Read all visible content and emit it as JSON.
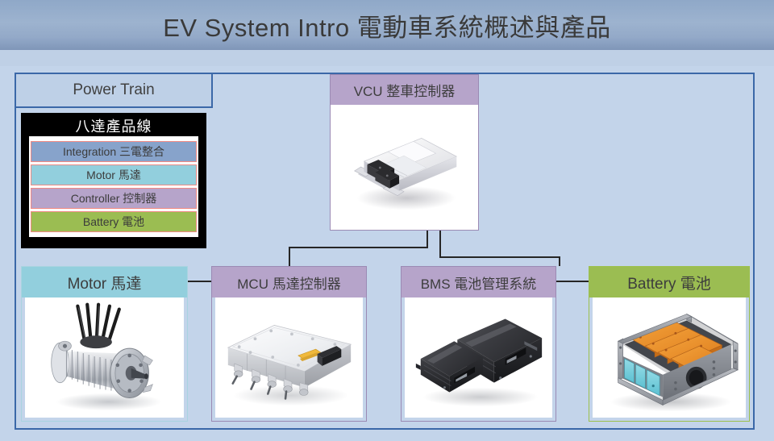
{
  "header": {
    "title": "EV System Intro 電動車系統概述與產品",
    "band_color": "#93a9c8"
  },
  "diagram": {
    "background_color": "#c3d4ea",
    "frame_border_color": "#3b68a8",
    "powertrain": {
      "label": "Power Train",
      "border_color": "#3b68a8",
      "fill_color": "#bed0e7"
    },
    "legend": {
      "title": "八達產品線",
      "title_bg": "#000000",
      "title_color": "#ffffff",
      "row_border_color": "#f08a84",
      "rows": [
        {
          "label": "Integration 三電整合",
          "color": "#87a3cb"
        },
        {
          "label": "Motor 馬達",
          "color": "#92cfdd"
        },
        {
          "label": "Controller 控制器",
          "color": "#b6a4ca"
        },
        {
          "label": "Battery 電池",
          "color": "#9bbd52"
        }
      ]
    },
    "cards": [
      {
        "id": "vcu",
        "label": "VCU 整車控制器",
        "header_color": "#b6a4ca",
        "border_color": "#9b8ab4",
        "image_name": "vcu-controller-photo"
      },
      {
        "id": "motor",
        "label": "Motor 馬達",
        "header_color": "#92cfdd",
        "border_color": "#a9d4e0",
        "image_name": "electric-motor-photo"
      },
      {
        "id": "mcu",
        "label": "MCU 馬達控制器",
        "header_color": "#b6a4ca",
        "border_color": "#9b8ab4",
        "image_name": "motor-controller-photo"
      },
      {
        "id": "bms",
        "label": "BMS 電池管理系統",
        "header_color": "#b6a4ca",
        "border_color": "#9b8ab4",
        "image_name": "bms-modules-photo"
      },
      {
        "id": "battery",
        "label": "Battery 電池",
        "header_color": "#9bbd52",
        "border_color": "#9cc04c",
        "image_name": "battery-pack-photo"
      }
    ],
    "connectors": [
      {
        "from": "vcu",
        "to": "mcu"
      },
      {
        "from": "vcu",
        "to": "bms"
      },
      {
        "from": "motor",
        "to": "mcu"
      },
      {
        "from": "bms",
        "to": "battery"
      }
    ],
    "connector_color": "#262626"
  }
}
